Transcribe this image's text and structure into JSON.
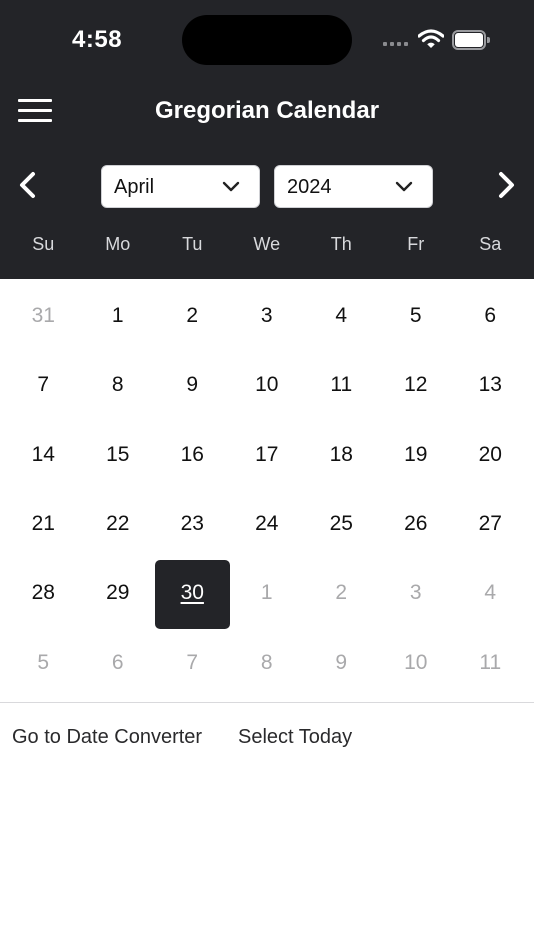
{
  "status_bar": {
    "time": "4:58",
    "icons": [
      "cellular-signal-icon",
      "wifi-icon",
      "battery-icon"
    ]
  },
  "header": {
    "title": "Gregorian Calendar",
    "menu_icon": "hamburger-menu-icon",
    "prev_icon": "chevron-left-icon",
    "next_icon": "chevron-right-icon"
  },
  "selectors": {
    "month": "April",
    "year": "2024"
  },
  "weekdays": [
    "Su",
    "Mo",
    "Tu",
    "We",
    "Th",
    "Fr",
    "Sa"
  ],
  "calendar": {
    "rows": [
      [
        {
          "d": "31",
          "m": true
        },
        {
          "d": "1"
        },
        {
          "d": "2"
        },
        {
          "d": "3"
        },
        {
          "d": "4"
        },
        {
          "d": "5"
        },
        {
          "d": "6"
        }
      ],
      [
        {
          "d": "7"
        },
        {
          "d": "8"
        },
        {
          "d": "9"
        },
        {
          "d": "10"
        },
        {
          "d": "11"
        },
        {
          "d": "12"
        },
        {
          "d": "13"
        }
      ],
      [
        {
          "d": "14"
        },
        {
          "d": "15"
        },
        {
          "d": "16"
        },
        {
          "d": "17"
        },
        {
          "d": "18"
        },
        {
          "d": "19"
        },
        {
          "d": "20"
        }
      ],
      [
        {
          "d": "21"
        },
        {
          "d": "22"
        },
        {
          "d": "23"
        },
        {
          "d": "24"
        },
        {
          "d": "25"
        },
        {
          "d": "26"
        },
        {
          "d": "27"
        }
      ],
      [
        {
          "d": "28"
        },
        {
          "d": "29"
        },
        {
          "d": "30",
          "sel": true
        },
        {
          "d": "1",
          "m": true
        },
        {
          "d": "2",
          "m": true
        },
        {
          "d": "3",
          "m": true
        },
        {
          "d": "4",
          "m": true
        }
      ],
      [
        {
          "d": "5",
          "m": true
        },
        {
          "d": "6",
          "m": true
        },
        {
          "d": "7",
          "m": true
        },
        {
          "d": "8",
          "m": true
        },
        {
          "d": "9",
          "m": true
        },
        {
          "d": "10",
          "m": true
        },
        {
          "d": "11",
          "m": true
        }
      ]
    ]
  },
  "footer": {
    "converter_label": "Go to Date Converter",
    "today_label": "Select Today"
  },
  "colors": {
    "header_bg": "#232428",
    "selected_bg": "#232428",
    "muted_day": "#a9a9ab"
  }
}
